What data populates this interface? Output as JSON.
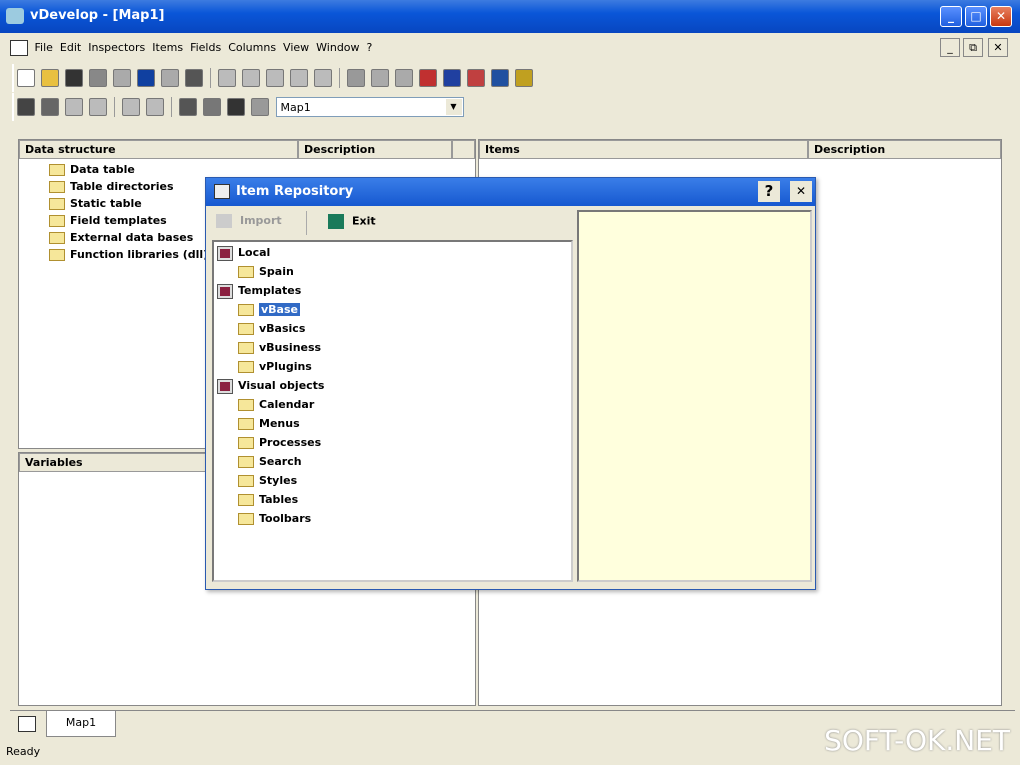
{
  "window": {
    "title": "vDevelop - [Map1]",
    "minimize": "_",
    "maximize": "□",
    "close": "✕"
  },
  "menu": [
    "File",
    "Edit",
    "Inspectors",
    "Items",
    "Fields",
    "Columns",
    "View",
    "Window",
    "?"
  ],
  "mdi": {
    "minimize": "_",
    "restore": "⧉",
    "close": "✕"
  },
  "toolbar": {
    "combo_value": "Map1"
  },
  "data_structure": {
    "headers": [
      "Data structure",
      "Description"
    ],
    "items": [
      "Data table",
      "Table directories",
      "Static table",
      "Field templates",
      "External data bases",
      "Function libraries (dll)"
    ]
  },
  "variables": {
    "header": "Variables"
  },
  "items_panel": {
    "headers": [
      "Items",
      "Description"
    ]
  },
  "dialog": {
    "title": "Item Repository",
    "help": "?",
    "close": "✕",
    "import": "Import",
    "exit": "Exit",
    "tree": [
      {
        "label": "Local",
        "level": 0
      },
      {
        "label": "Spain",
        "level": 1
      },
      {
        "label": "Templates",
        "level": 0
      },
      {
        "label": "vBase",
        "level": 1,
        "selected": true
      },
      {
        "label": "vBasics",
        "level": 1
      },
      {
        "label": "vBusiness",
        "level": 1
      },
      {
        "label": "vPlugins",
        "level": 1
      },
      {
        "label": "Visual objects",
        "level": 0
      },
      {
        "label": "Calendar",
        "level": 1
      },
      {
        "label": "Menus",
        "level": 1
      },
      {
        "label": "Processes",
        "level": 1
      },
      {
        "label": "Search",
        "level": 1
      },
      {
        "label": "Styles",
        "level": 1
      },
      {
        "label": "Tables",
        "level": 1
      },
      {
        "label": "Toolbars",
        "level": 1
      }
    ]
  },
  "tabs": [
    {
      "label": "Map1"
    }
  ],
  "status": "Ready",
  "watermark": "SOFT-OK.NET"
}
